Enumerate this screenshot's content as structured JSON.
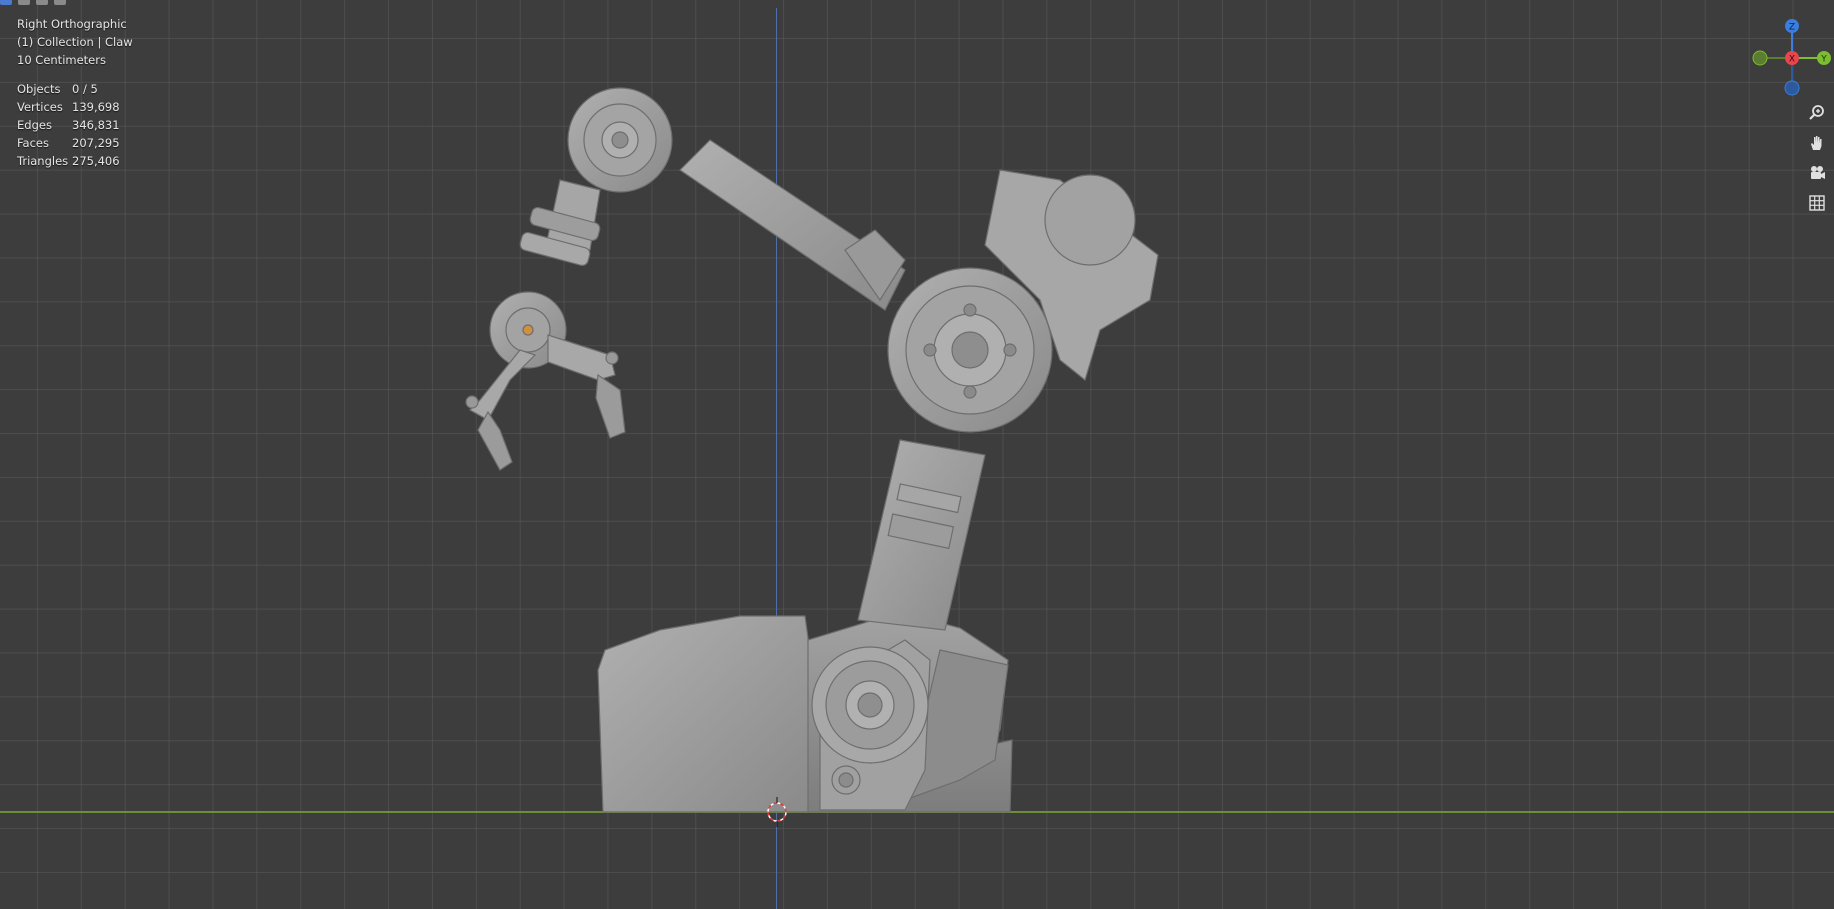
{
  "viewport": {
    "view_name": "Right Orthographic",
    "collection_line": "(1) Collection | Claw",
    "grid_scale": "10 Centimeters"
  },
  "statistics": [
    {
      "label": "Objects",
      "value": "0 / 5"
    },
    {
      "label": "Vertices",
      "value": "139,698"
    },
    {
      "label": "Edges",
      "value": "346,831"
    },
    {
      "label": "Faces",
      "value": "207,295"
    },
    {
      "label": "Triangles",
      "value": "275,406"
    }
  ],
  "gizmo": {
    "z_label": "Z",
    "x_label": "X",
    "y_label": "Y",
    "colors": {
      "x": "#e8464d",
      "y": "#7cbd31",
      "z": "#3a7ee0",
      "neg_y": "#5b7d2f",
      "neg_z": "#2d5a9c"
    }
  },
  "navigation_tools": [
    {
      "icon": "zoom-icon"
    },
    {
      "icon": "pan-hand-icon"
    },
    {
      "icon": "camera-icon"
    },
    {
      "icon": "grid-perspective-icon"
    }
  ],
  "colors": {
    "background": "#3d3d3d",
    "grid_line": "#555555",
    "axis_vertical": "#4f6fa8",
    "axis_horizontal": "#6a8f35",
    "model_fill": "#9a9a9a"
  }
}
